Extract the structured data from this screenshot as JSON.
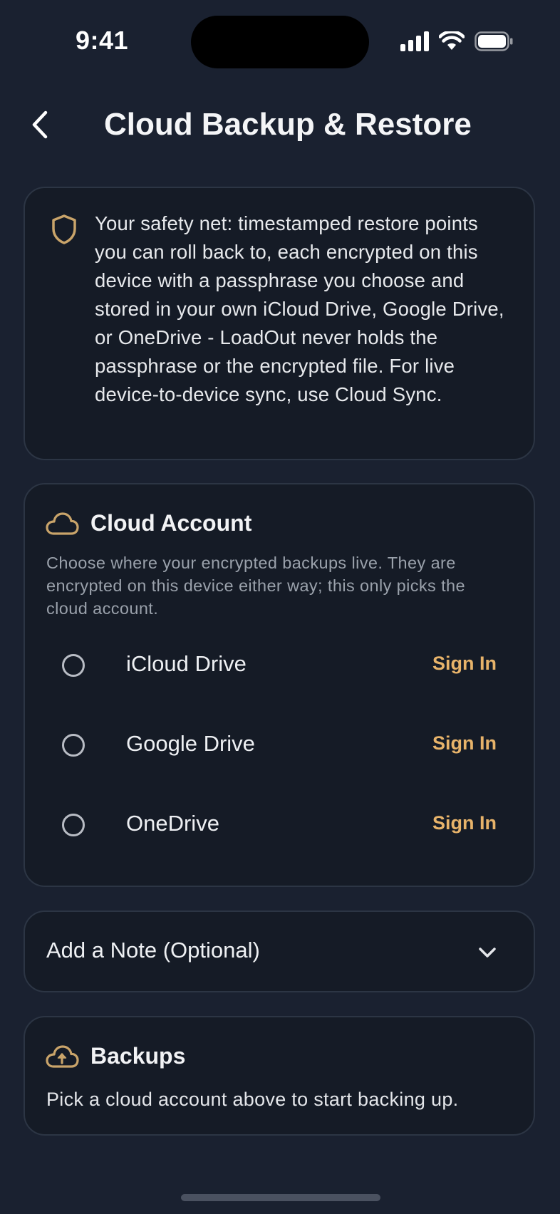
{
  "status_bar": {
    "time": "9:41",
    "icons": [
      "cellular-signal-icon",
      "wifi-icon",
      "battery-icon"
    ]
  },
  "header": {
    "back_icon": "chevron-left-icon",
    "title": "Cloud Backup & Restore"
  },
  "intro": {
    "icon": "shield-icon",
    "text": "Your safety net: timestamped restore points you can roll back to, each encrypted on this device with a passphrase you choose and stored in your own iCloud Drive, Google Drive, or OneDrive - LoadOut never holds the passphrase or the encrypted file. For live device-to-device sync, use Cloud Sync."
  },
  "cloud_account": {
    "icon": "cloud-icon",
    "title": "Cloud Account",
    "description": "Choose where your encrypted backups live. They are encrypted on this device either way; this only picks the cloud account.",
    "providers": [
      {
        "name": "iCloud Drive",
        "action": "Sign In",
        "selected": false
      },
      {
        "name": "Google Drive",
        "action": "Sign In",
        "selected": false
      },
      {
        "name": "OneDrive",
        "action": "Sign In",
        "selected": false
      }
    ]
  },
  "note": {
    "label": "Add a Note (Optional)",
    "icon": "chevron-down-icon"
  },
  "backups": {
    "icon": "cloud-upload-icon",
    "title": "Backups",
    "description": "Pick a cloud account above to start backing up."
  },
  "colors": {
    "background": "#1a2130",
    "card": "#151b26",
    "card_border": "#2c3544",
    "accent": "#e7b36a",
    "icon_gold": "#c9a46a"
  }
}
